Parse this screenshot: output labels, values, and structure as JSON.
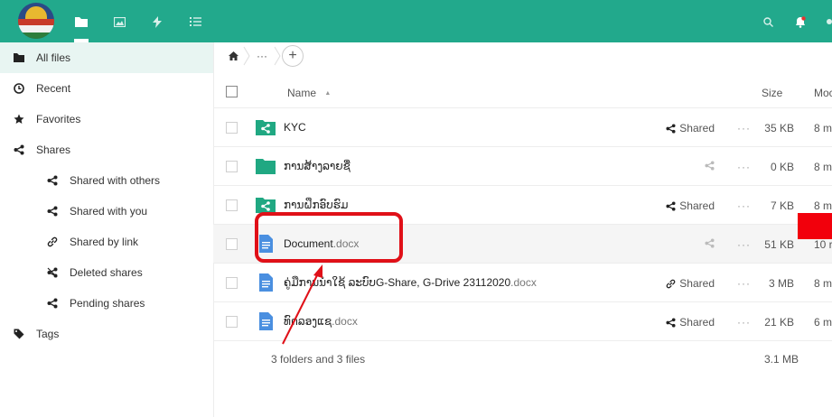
{
  "header": {
    "nav": [
      {
        "name": "files-icon"
      },
      {
        "name": "photos-icon"
      },
      {
        "name": "activity-icon"
      },
      {
        "name": "tasks-icon"
      }
    ]
  },
  "sidebar": {
    "items": [
      {
        "label": "All files",
        "icon": "folder-icon"
      },
      {
        "label": "Recent",
        "icon": "clock-icon"
      },
      {
        "label": "Favorites",
        "icon": "star-icon"
      },
      {
        "label": "Shares",
        "icon": "share-icon"
      },
      {
        "label": "Shared with others",
        "icon": "share-icon"
      },
      {
        "label": "Shared with you",
        "icon": "share-icon"
      },
      {
        "label": "Shared by link",
        "icon": "link-icon"
      },
      {
        "label": "Deleted shares",
        "icon": "deleted-share-icon"
      },
      {
        "label": "Pending shares",
        "icon": "share-icon"
      },
      {
        "label": "Tags",
        "icon": "tag-icon"
      }
    ]
  },
  "breadcrumb": {
    "more": "···",
    "add": "+"
  },
  "table": {
    "headers": {
      "name": "Name",
      "sort": "▲",
      "size": "Size",
      "modified": "Moc"
    },
    "rows": [
      {
        "name": "KYC",
        "type": "shared-folder",
        "share": "Shared",
        "size": "35 KB",
        "mod": "8 m"
      },
      {
        "name": "ການສ້າງລາຍຊື່",
        "type": "folder",
        "share": "",
        "size": "0 KB",
        "mod": "8 m"
      },
      {
        "name": "ການຝຶກອົບຮົມ",
        "type": "shared-folder",
        "share": "Shared",
        "size": "7 KB",
        "mod": "8 m"
      },
      {
        "name": "Document",
        "ext": ".docx",
        "type": "doc",
        "share": "",
        "size": "51 KB",
        "mod": "10 r"
      },
      {
        "name": "ຄູ່ມືການນຳໃຊ້ ລະບົບG-Share, G-Drive 23112020",
        "ext": ".docx",
        "type": "doc",
        "share": "Shared",
        "shareIcon": "link",
        "size": "3 MB",
        "mod": "8 m"
      },
      {
        "name": "ທົດລອງແຊ",
        "ext": ".docx",
        "type": "doc",
        "share": "Shared",
        "size": "21 KB",
        "mod": "6 m"
      }
    ],
    "summary": "3 folders and 3 files",
    "summary_size": "3.1 MB",
    "dots": "···"
  }
}
